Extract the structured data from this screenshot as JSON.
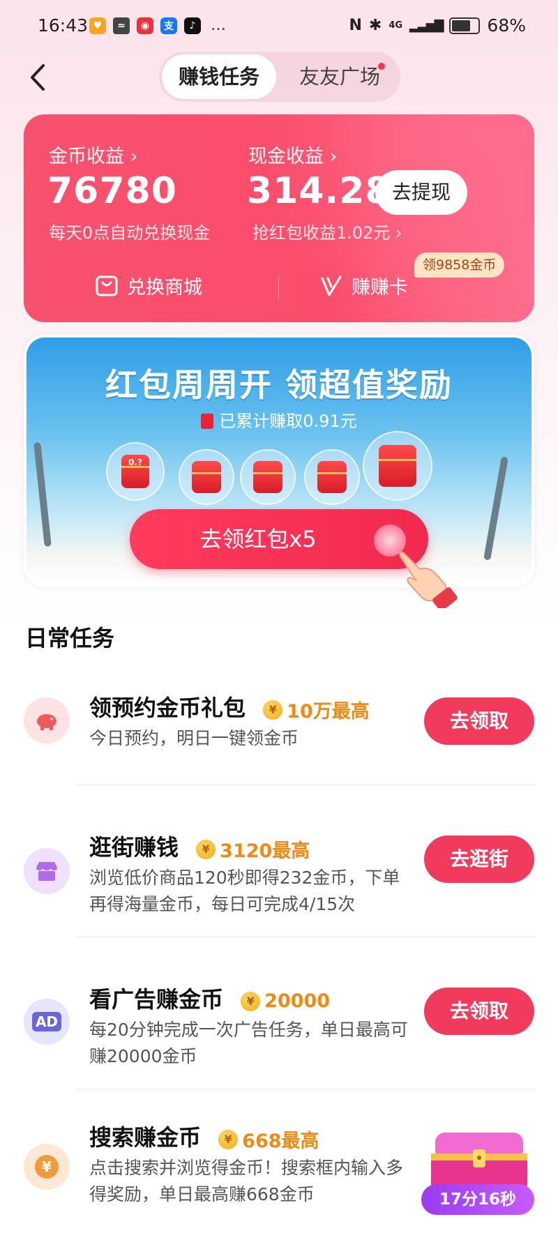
{
  "status_bar": {
    "time": "16:43",
    "network": "4G",
    "battery": "68%",
    "more": "…"
  },
  "header": {
    "tabs": [
      {
        "label": "赚钱任务",
        "active": true
      },
      {
        "label": "友友广场",
        "active": false,
        "has_dot": true
      }
    ]
  },
  "earnings": {
    "coins": {
      "label": "金币收益 ›",
      "value": "76780",
      "sub": "每天0点自动兑换现金"
    },
    "cash": {
      "label": "现金收益 ›",
      "value": "314.28",
      "sub": "抢红包收益1.02元 ›"
    },
    "withdraw_label": "去提现",
    "shop_label": "兑换商城",
    "card_label": "赚赚卡",
    "card_badge": "领9858金币"
  },
  "banner": {
    "title": "红包周周开 领超值奖励",
    "subtitle": "已累计赚取0.91元",
    "first_packet": "0.?",
    "cta_label": "去领红包x5"
  },
  "daily": {
    "title": "日常任务",
    "tasks": [
      {
        "title": "领预约金币礼包",
        "reward": "10万最高",
        "desc": "今日预约，明日一键领金币",
        "button": "去领取",
        "icon": "piggy-bank-icon",
        "icon_text": ""
      },
      {
        "title": "逛街赚钱",
        "reward": "3120最高",
        "desc": "浏览低价商品120秒即得232金币，下单再得海量金币，每日可完成4/15次",
        "button": "去逛街",
        "icon": "shop-icon",
        "icon_text": ""
      },
      {
        "title": "看广告赚金币",
        "reward": "20000",
        "desc": "每20分钟完成一次广告任务，单日最高可赚20000金币",
        "button": "去领取",
        "icon": "ad-icon",
        "icon_text": "AD"
      },
      {
        "title": "搜索赚金币",
        "reward": "668最高",
        "desc": "点击搜索并浏览得金币！搜索框内输入多得奖励，单日最高赚668金币",
        "button": "",
        "icon": "yen-coin-icon",
        "icon_text": "¥"
      }
    ]
  },
  "treasure": {
    "timer": "17分16秒"
  },
  "colors": {
    "primary": "#f23a5c",
    "reward": "#f08a12",
    "card": "#f8516e"
  }
}
